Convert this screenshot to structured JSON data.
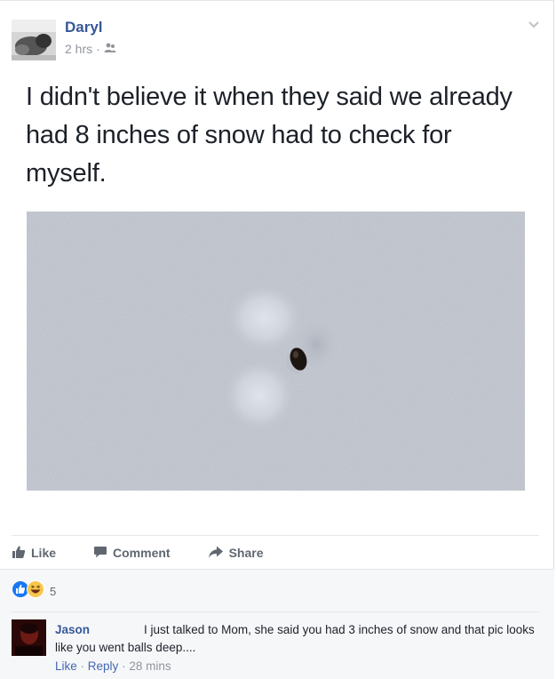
{
  "post": {
    "author": "Daryl",
    "time": "2 hrs",
    "separator": "·",
    "privacy_icon": "friends-icon",
    "text": "I didn't believe it when they said we already had 8 inches of snow had to check for myself."
  },
  "actions": {
    "like": "Like",
    "comment": "Comment",
    "share": "Share"
  },
  "reactions": {
    "types": [
      "like",
      "haha"
    ],
    "count": "5"
  },
  "comment": {
    "author": "Jason",
    "text": "I just talked to Mom, she said you had 3 inches of snow and that pic looks like you went balls deep....",
    "like_label": "Like",
    "reply_label": "Reply",
    "separator": "·",
    "time": "28 mins"
  },
  "colors": {
    "link_blue": "#365899",
    "action_gray": "#606770",
    "meta_gray": "#90949c",
    "like_blue": "#1877f2",
    "haha_yellow": "#f7c64b"
  }
}
